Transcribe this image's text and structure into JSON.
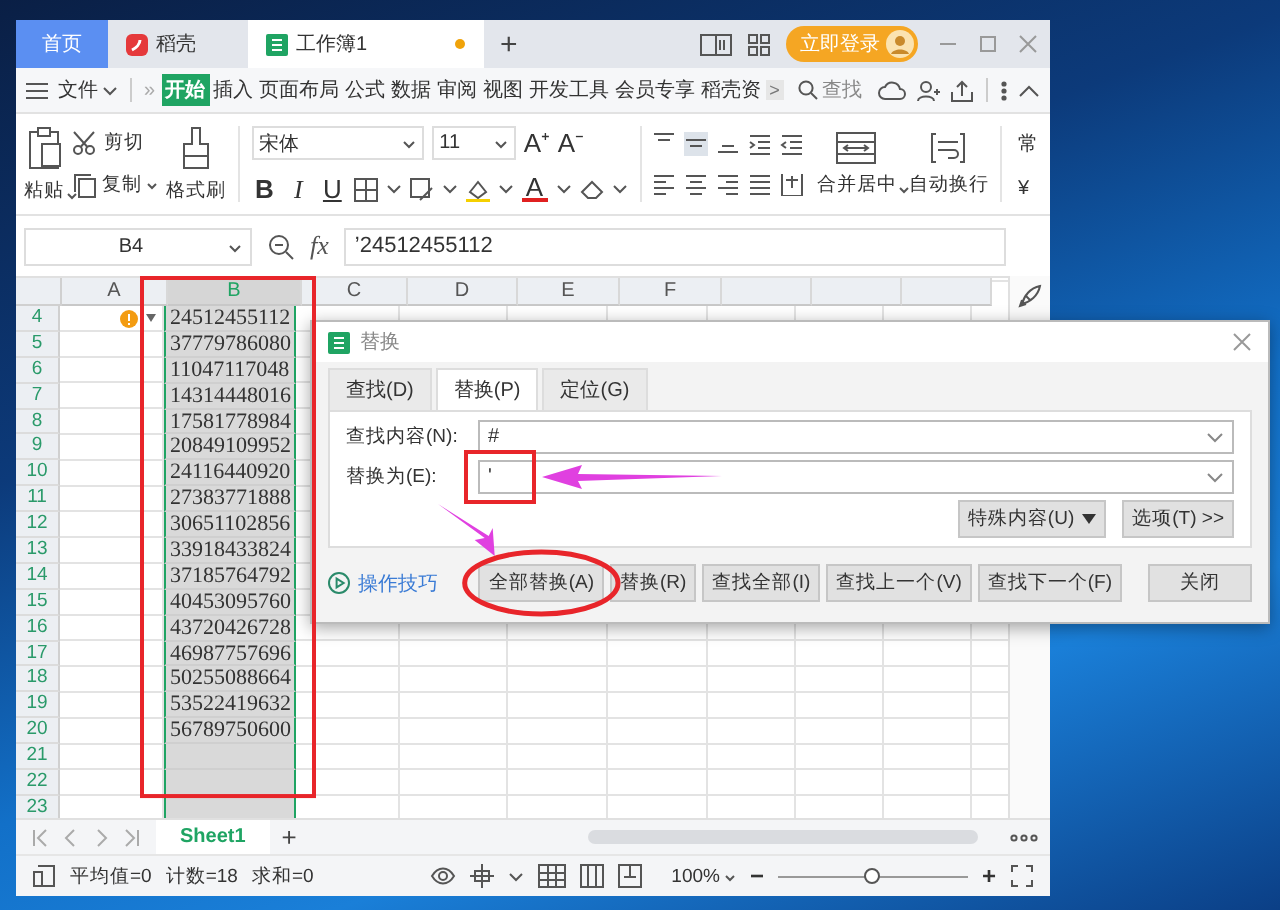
{
  "tabs": [
    {
      "label": "首页",
      "kind": "home",
      "selected": false,
      "unsaved": false
    },
    {
      "label": "稻壳",
      "kind": "docer",
      "selected": false,
      "unsaved": false
    },
    {
      "label": "工作簿1",
      "kind": "workbook",
      "selected": true,
      "unsaved": true
    }
  ],
  "new_tab": "+",
  "login_button": "立即登录",
  "menu": {
    "file": "文件",
    "more": "»",
    "scroll": ">",
    "search": "查找",
    "items": [
      {
        "label": "开始",
        "selected": true
      },
      {
        "label": "插入",
        "selected": false
      },
      {
        "label": "页面布局",
        "selected": false
      },
      {
        "label": "公式",
        "selected": false
      },
      {
        "label": "数据",
        "selected": false
      },
      {
        "label": "审阅",
        "selected": false
      },
      {
        "label": "视图",
        "selected": false
      },
      {
        "label": "开发工具",
        "selected": false
      },
      {
        "label": "会员专享",
        "selected": false
      },
      {
        "label": "稻壳资",
        "selected": false
      }
    ]
  },
  "ribbon": {
    "paste": "粘贴",
    "cut": "剪切",
    "copy": "复制",
    "format_painter": "格式刷",
    "font": "宋体",
    "font_size": "11",
    "grow_font": "A⁺",
    "shrink_font": "A⁻",
    "bold": "B",
    "italic": "I",
    "underline": "U",
    "font_color": "A",
    "merge": "合并居中",
    "wrap": "自动换行",
    "number_format": "常",
    "currency": "¥"
  },
  "formula_bar": {
    "cell": "B4",
    "fx": "fx",
    "formula": "’24512455112"
  },
  "columns": [
    {
      "label": "A",
      "selected": false
    },
    {
      "label": "B",
      "selected": true
    },
    {
      "label": "C",
      "selected": false
    },
    {
      "label": "D",
      "selected": false
    },
    {
      "label": "E",
      "selected": false
    },
    {
      "label": "F",
      "selected": false
    }
  ],
  "rows": [
    {
      "number": "4",
      "value": "24512455112",
      "warning": true
    },
    {
      "number": "5",
      "value": "37779786080",
      "warning": false
    },
    {
      "number": "6",
      "value": "11047117048",
      "warning": false
    },
    {
      "number": "7",
      "value": "14314448016",
      "warning": false
    },
    {
      "number": "8",
      "value": "17581778984",
      "warning": false
    },
    {
      "number": "9",
      "value": "20849109952",
      "warning": false
    },
    {
      "number": "10",
      "value": "24116440920",
      "warning": false
    },
    {
      "number": "11",
      "value": "27383771888",
      "warning": false
    },
    {
      "number": "12",
      "value": "30651102856",
      "warning": false
    },
    {
      "number": "13",
      "value": "33918433824",
      "warning": false
    },
    {
      "number": "14",
      "value": "37185764792",
      "warning": false
    },
    {
      "number": "15",
      "value": "40453095760",
      "warning": false
    },
    {
      "number": "16",
      "value": "43720426728",
      "warning": false
    },
    {
      "number": "17",
      "value": "46987757696",
      "warning": false
    },
    {
      "number": "18",
      "value": "50255088664",
      "warning": false
    },
    {
      "number": "19",
      "value": "53522419632",
      "warning": false
    },
    {
      "number": "20",
      "value": "56789750600",
      "warning": false
    },
    {
      "number": "21",
      "warning": false
    },
    {
      "number": "22",
      "warning": false
    },
    {
      "number": "23",
      "warning": false
    }
  ],
  "sheet_tabs": [
    {
      "label": "Sheet1",
      "selected": true
    }
  ],
  "add_sheet": "+",
  "status_bar": {
    "average": "平均值=0",
    "count": "计数=18",
    "sum": "求和=0",
    "zoom": "100%",
    "zoom_out": "−",
    "zoom_in": "+",
    "zoom_slider": {
      "level": 0.5
    }
  },
  "dialog": {
    "title": "替换",
    "tabs": [
      {
        "label": "查找(D)",
        "selected": false
      },
      {
        "label": "替换(P)",
        "selected": true
      },
      {
        "label": "定位(G)",
        "selected": false
      }
    ],
    "find_label": "查找内容(N):",
    "find_value": "#",
    "replace_label": "替换为(E):",
    "replace_value": "'",
    "special_button": "特殊内容(U)",
    "options_button": "选项(T) >>",
    "tips_link": "操作技巧",
    "buttons": [
      "全部替换(A)",
      "替换(R)",
      "查找全部(I)",
      "查找上一个(V)",
      "查找下一个(F)",
      "关闭"
    ]
  }
}
